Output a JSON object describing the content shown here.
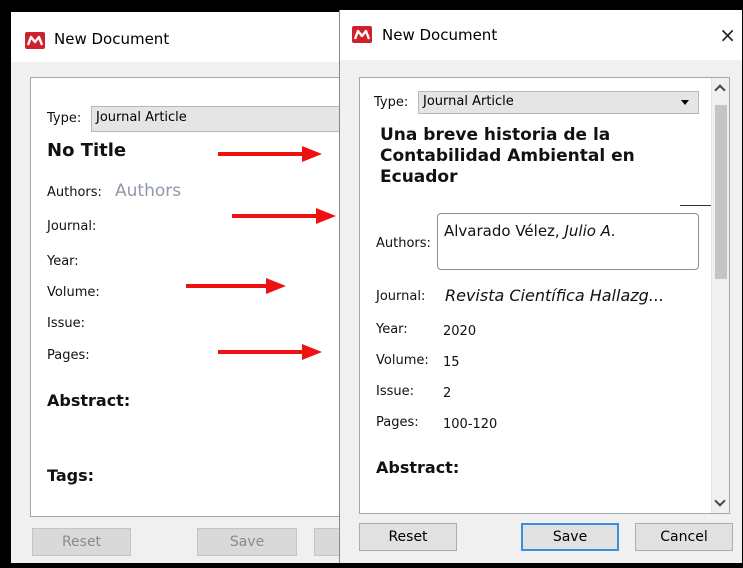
{
  "left_window": {
    "title": "New Document",
    "type_label": "Type:",
    "type_value": "Journal Article",
    "doc_title": "No Title",
    "authors_label": "Authors:",
    "authors_placeholder": "Authors",
    "journal_label": "Journal:",
    "year_label": "Year:",
    "volume_label": "Volume:",
    "issue_label": "Issue:",
    "pages_label": "Pages:",
    "abstract_label": "Abstract:",
    "tags_label": "Tags:",
    "reset_label": "Reset",
    "save_label": "Save"
  },
  "right_window": {
    "title": "New Document",
    "close_glyph": "×",
    "type_label": "Type:",
    "type_value": "Journal Article",
    "doc_title_line1": "Una breve historia de la",
    "doc_title_line2": "Contabilidad Ambiental en",
    "doc_title_line3": "Ecuador",
    "authors_label": "Authors:",
    "author_lastname": "Alvarado Vélez,",
    "author_firstname": "Julio A.",
    "journal_label": "Journal:",
    "journal_value": "Revista Científica Hallazg...",
    "year_label": "Year:",
    "year_value": "2020",
    "volume_label": "Volume:",
    "volume_value": "15",
    "issue_label": "Issue:",
    "issue_value": "2",
    "pages_label": "Pages:",
    "pages_value": "100-120",
    "abstract_label": "Abstract:",
    "reset_label": "Reset",
    "save_label": "Save",
    "cancel_label": "Cancel"
  },
  "colors": {
    "arrow": "#ee1111",
    "logo": "#d0202e",
    "primary_border": "#3a8ee0"
  },
  "icons": [
    "mendeley-logo-icon",
    "close-icon",
    "dropdown-arrow-icon",
    "scroll-up-icon",
    "scroll-down-icon",
    "red-arrow-icon"
  ]
}
